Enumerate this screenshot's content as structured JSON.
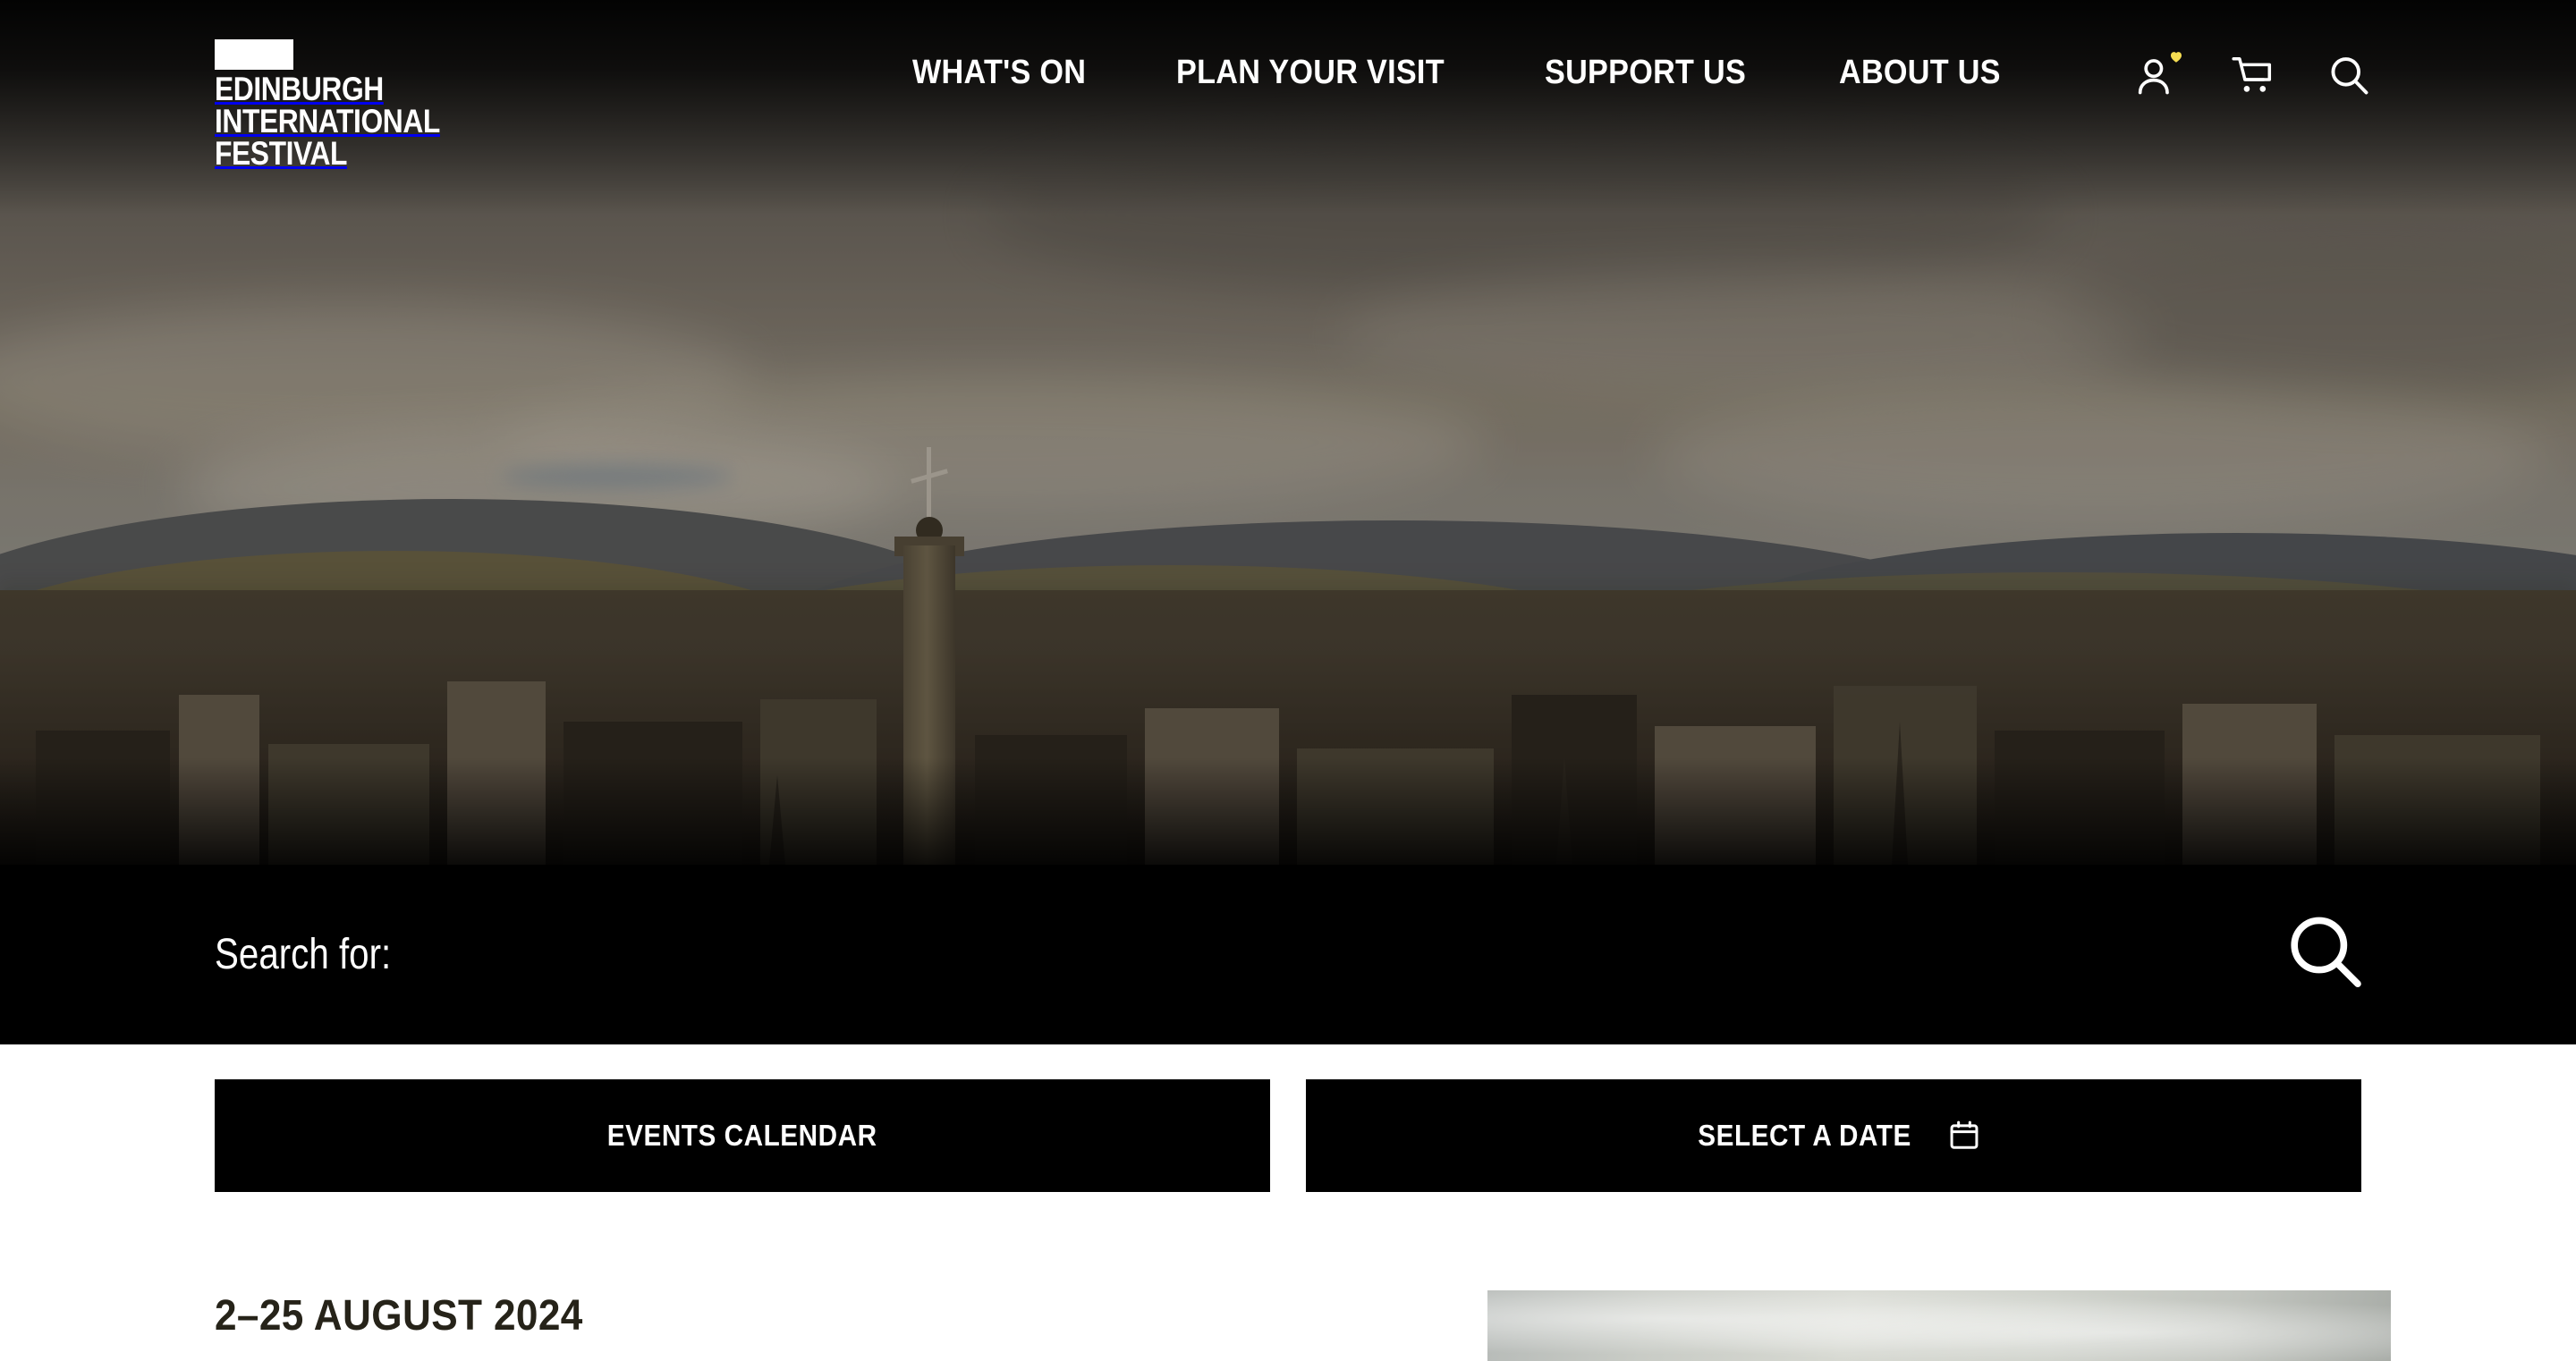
{
  "site": {
    "logo_text_lines": [
      "EDINBURGH",
      "INTERNATIONAL",
      "FESTIVAL"
    ],
    "logo_line1": "EDINBURGH",
    "logo_line2": "INTERNATIONAL",
    "logo_line3": "FESTIVAL"
  },
  "nav": {
    "items": [
      {
        "label": "WHAT'S ON",
        "name": "nav-whats-on"
      },
      {
        "label": "PLAN YOUR VISIT",
        "name": "nav-plan-your-visit"
      },
      {
        "label": "SUPPORT US",
        "name": "nav-support-us"
      },
      {
        "label": "ABOUT US",
        "name": "nav-about-us"
      }
    ]
  },
  "header_icons": [
    {
      "name": "account-icon",
      "label": "Account"
    },
    {
      "name": "cart-icon",
      "label": "Basket"
    },
    {
      "name": "search-icon",
      "label": "Search"
    }
  ],
  "search": {
    "placeholder": "Search for:",
    "value": "",
    "submit_icon": "search-icon"
  },
  "buttons": {
    "events_calendar": "EVENTS CALENDAR",
    "select_a_date": "SELECT A DATE",
    "select_a_date_icon": "calendar-icon"
  },
  "content": {
    "date_heading": "2–25 AUGUST 2024"
  },
  "colors": {
    "accent_heart": "#f5dd52",
    "black": "#000000",
    "white": "#ffffff",
    "heading": "#262319"
  }
}
